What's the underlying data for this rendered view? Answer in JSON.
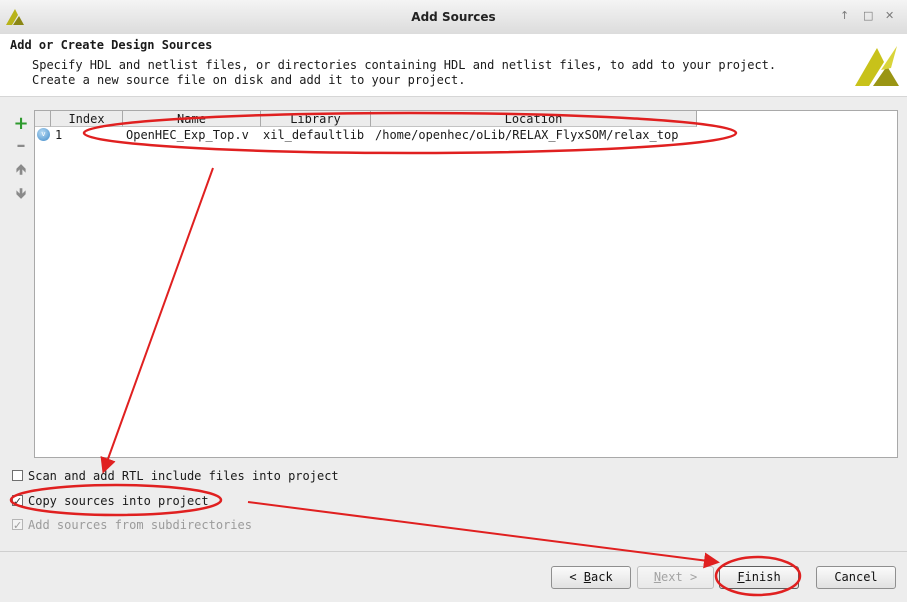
{
  "window": {
    "title": "Add Sources",
    "controls": [
      "↑",
      "□",
      "✕"
    ]
  },
  "header": {
    "title": "Add or Create Design Sources",
    "desc_line1": "Specify HDL and netlist files, or directories containing HDL and netlist files, to add to your project.",
    "desc_line2": "Create a new source file on disk and add it to your project."
  },
  "toolbar": {
    "add_icon": "plus-icon",
    "remove_icon": "minus-icon",
    "up_icon": "arrow-up-icon",
    "down_icon": "arrow-down-icon"
  },
  "table": {
    "columns": [
      "Index",
      "Name",
      "Library",
      "Location"
    ],
    "rows": [
      {
        "index": "1",
        "name": "OpenHEC_Exp_Top.v",
        "library": "xil_defaultlib",
        "location": "/home/openhec/oLib/RELAX_FlyxSOM/relax_top"
      }
    ]
  },
  "options": [
    {
      "label": "Scan and add RTL include files into project",
      "checked": false,
      "enabled": true
    },
    {
      "label": "Copy sources into project",
      "checked": true,
      "enabled": true
    },
    {
      "label": "Add sources from subdirectories",
      "checked": true,
      "enabled": false
    }
  ],
  "buttons": {
    "back": {
      "prefix": "< ",
      "mnemonic": "B",
      "rest": "ack"
    },
    "next": {
      "prefix": "",
      "mnemonic": "N",
      "rest": "ext >"
    },
    "finish": {
      "prefix": "",
      "mnemonic": "F",
      "rest": "inish"
    },
    "cancel": {
      "label": "Cancel"
    }
  },
  "colors": {
    "annotation_red": "#e02020",
    "add_green": "#2e9a2e",
    "logo_yellow": "#c8c21a"
  }
}
